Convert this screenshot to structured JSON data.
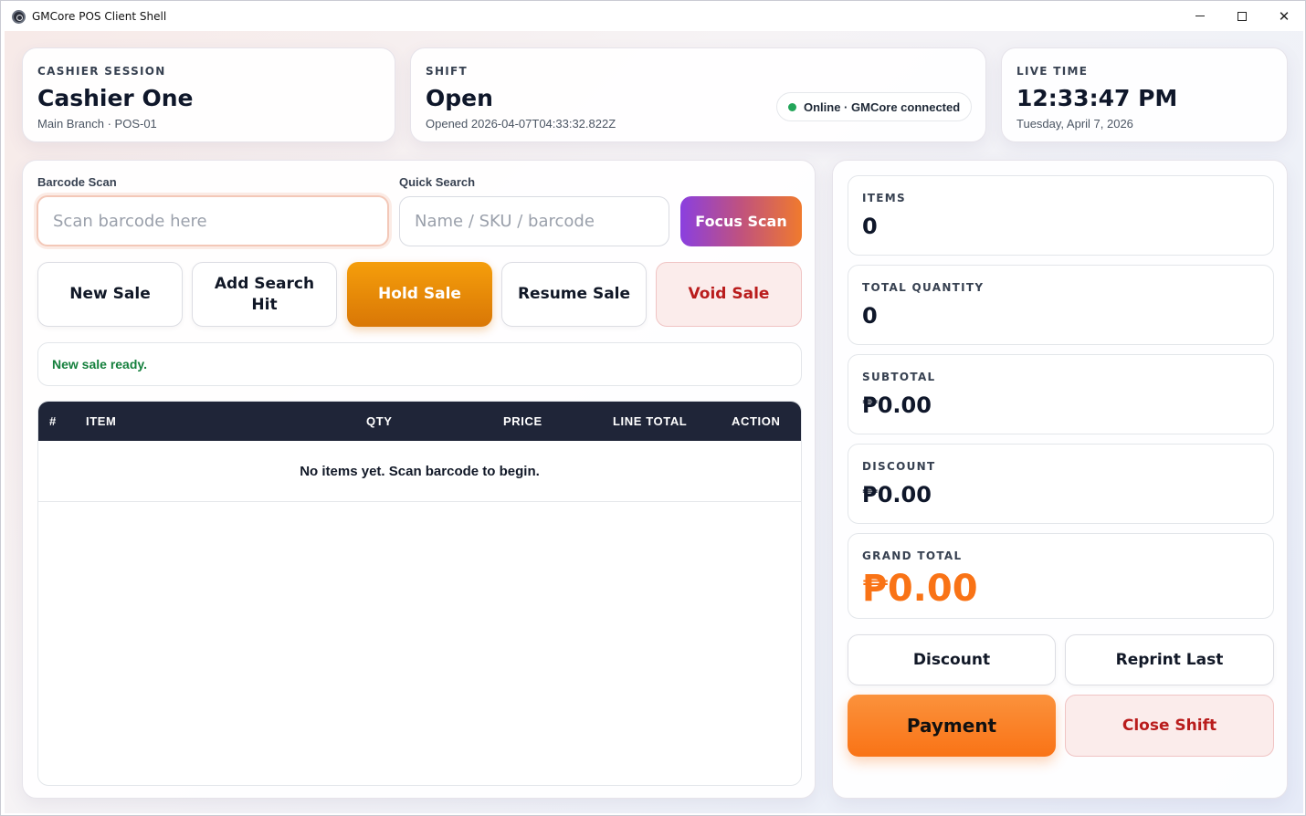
{
  "window": {
    "title": "GMCore POS Client Shell"
  },
  "session": {
    "label": "CASHIER SESSION",
    "name": "Cashier One",
    "detail": "Main Branch · POS-01"
  },
  "shift": {
    "label": "SHIFT",
    "status": "Open",
    "opened": "Opened 2026-04-07T04:33:32.822Z",
    "connection": "Online · GMCore connected",
    "connection_color": "#22a559"
  },
  "clock": {
    "label": "LIVE TIME",
    "time": "12:33:47 PM",
    "date": "Tuesday, April 7, 2026"
  },
  "scan": {
    "barcode_label": "Barcode Scan",
    "barcode_placeholder": "Scan barcode here",
    "search_label": "Quick Search",
    "search_placeholder": "Name / SKU / barcode",
    "focus_button": "Focus Scan"
  },
  "actions": {
    "new_sale": "New Sale",
    "add_search_hit": "Add Search Hit",
    "hold_sale": "Hold Sale",
    "resume_sale": "Resume Sale",
    "void_sale": "Void Sale"
  },
  "notice": "New sale ready.",
  "cart": {
    "columns": [
      "#",
      "ITEM",
      "QTY",
      "PRICE",
      "LINE TOTAL",
      "ACTION"
    ],
    "empty_message": "No items yet. Scan barcode to begin."
  },
  "summary": {
    "items_label": "ITEMS",
    "items": "0",
    "qty_label": "TOTAL QUANTITY",
    "qty": "0",
    "subtotal_label": "SUBTOTAL",
    "subtotal": "₱0.00",
    "discount_label": "DISCOUNT",
    "discount": "₱0.00",
    "grand_label": "GRAND TOTAL",
    "grand": "₱0.00"
  },
  "footer_buttons": {
    "discount": "Discount",
    "reprint": "Reprint Last",
    "payment": "Payment",
    "close_shift": "Close Shift"
  },
  "colors": {
    "accent_orange": "#f97316",
    "danger": "#b91c1c",
    "header_dark": "#1f2538",
    "success": "#15803d"
  }
}
